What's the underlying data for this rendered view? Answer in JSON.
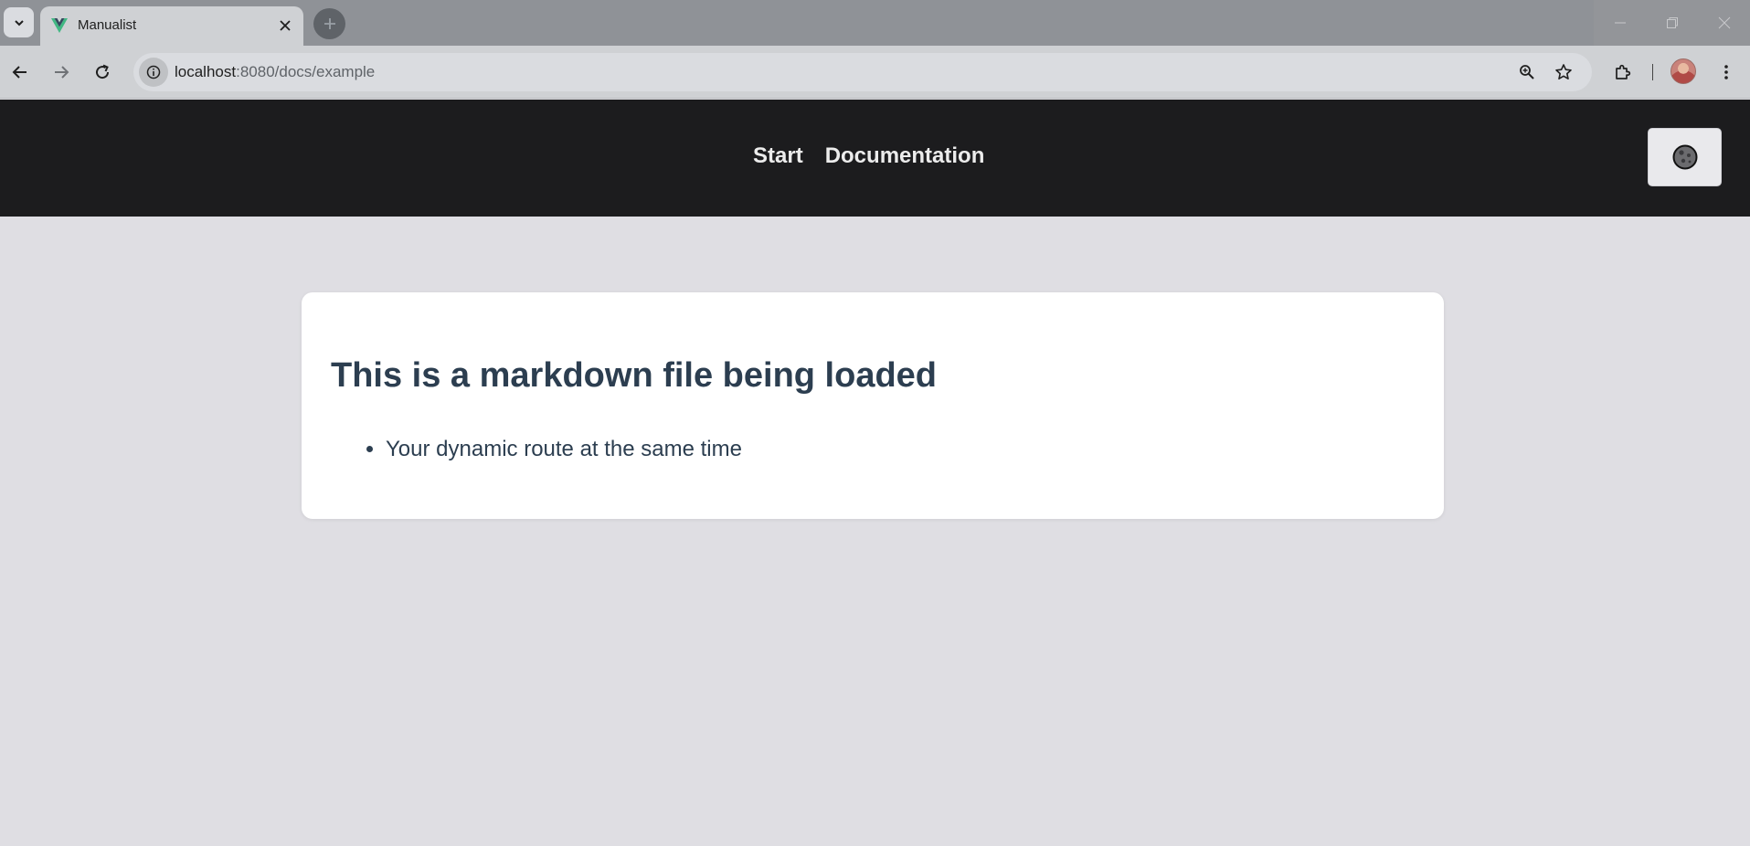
{
  "browser": {
    "tab": {
      "title": "Manualist",
      "favicon": "vue-logo-icon"
    },
    "address": {
      "host": "localhost",
      "path": ":8080/docs/example"
    }
  },
  "nav": {
    "links": [
      {
        "label": "Start"
      },
      {
        "label": "Documentation"
      }
    ],
    "theme_toggle_icon": "moon-icon"
  },
  "content": {
    "heading": "This is a markdown file being loaded",
    "bullets": [
      "Your dynamic route at the same time"
    ]
  },
  "colors": {
    "navbar_bg": "#1c1c1e",
    "page_bg": "#dfdee3",
    "text": "#2c3e50",
    "vue_green": "#41b883",
    "vue_dark": "#35495e"
  }
}
